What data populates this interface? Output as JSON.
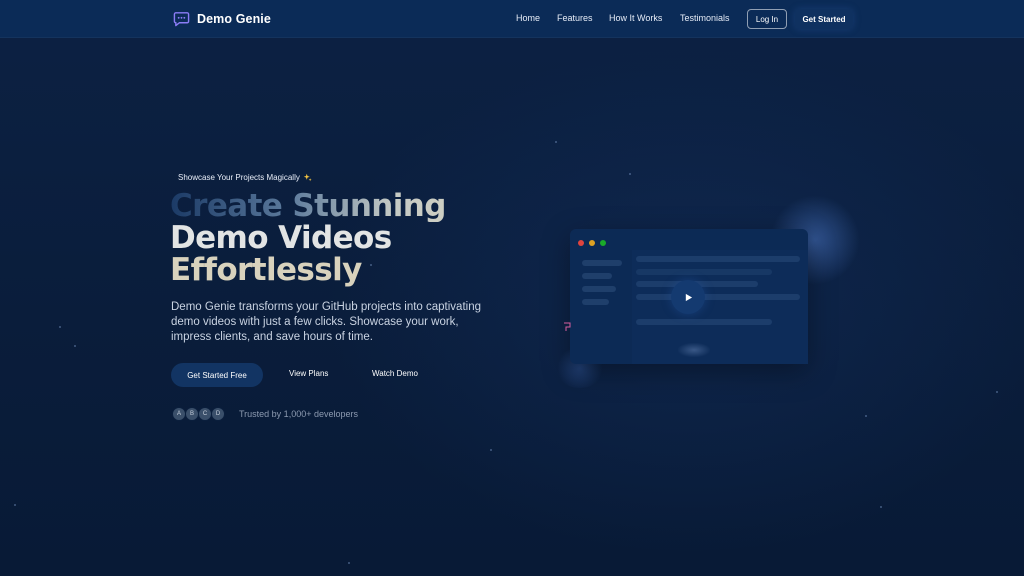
{
  "brand": {
    "name": "Demo Genie",
    "icon": "chat-bubble-icon"
  },
  "nav": {
    "links": [
      "Home",
      "Features",
      "How It Works",
      "Testimonials"
    ],
    "login_label": "Log In",
    "get_started_label": "Get Started"
  },
  "hero": {
    "tagline": "Showcase Your Projects Magically",
    "tagline_icon": "sparkles-icon",
    "headline": [
      "Create Stunning",
      "Demo Videos",
      "Effortlessly"
    ],
    "description": "Demo Genie transforms your GitHub projects into captivating demo videos with just a few clicks. Showcase your work, impress clients, and save hours of time.",
    "cta_primary": "Get Started Free",
    "cta_plans": "View Plans",
    "cta_demo": "Watch Demo",
    "avatars": [
      "A",
      "B",
      "C",
      "D"
    ],
    "trusted_text": "Trusted by 1,000+ developers"
  },
  "mockup": {
    "window_dot_colors": [
      "#e0443e",
      "#dea123",
      "#1aab29"
    ],
    "play_icon": "play-icon",
    "flag_icon": "bookmark-icon"
  },
  "colors": {
    "background": "#0b1f3d",
    "nav_background": "#0b2b57",
    "primary_button": "#123463",
    "headline_gold": "#d8d2bd"
  }
}
